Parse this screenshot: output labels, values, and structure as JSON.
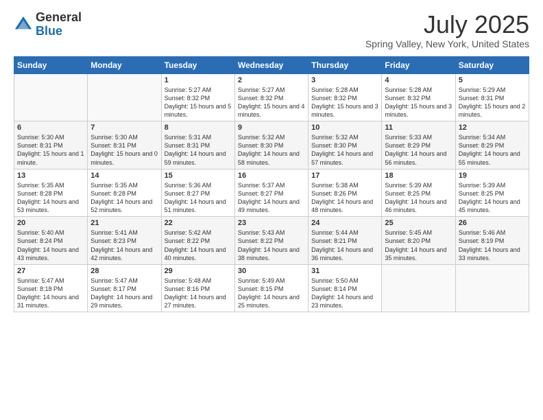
{
  "header": {
    "logo_general": "General",
    "logo_blue": "Blue",
    "month": "July 2025",
    "location": "Spring Valley, New York, United States"
  },
  "weekdays": [
    "Sunday",
    "Monday",
    "Tuesday",
    "Wednesday",
    "Thursday",
    "Friday",
    "Saturday"
  ],
  "weeks": [
    [
      {
        "day": "",
        "empty": true
      },
      {
        "day": "",
        "empty": true
      },
      {
        "day": "1",
        "sunrise": "Sunrise: 5:27 AM",
        "sunset": "Sunset: 8:32 PM",
        "daylight": "Daylight: 15 hours and 5 minutes."
      },
      {
        "day": "2",
        "sunrise": "Sunrise: 5:27 AM",
        "sunset": "Sunset: 8:32 PM",
        "daylight": "Daylight: 15 hours and 4 minutes."
      },
      {
        "day": "3",
        "sunrise": "Sunrise: 5:28 AM",
        "sunset": "Sunset: 8:32 PM",
        "daylight": "Daylight: 15 hours and 3 minutes."
      },
      {
        "day": "4",
        "sunrise": "Sunrise: 5:28 AM",
        "sunset": "Sunset: 8:32 PM",
        "daylight": "Daylight: 15 hours and 3 minutes."
      },
      {
        "day": "5",
        "sunrise": "Sunrise: 5:29 AM",
        "sunset": "Sunset: 8:31 PM",
        "daylight": "Daylight: 15 hours and 2 minutes."
      }
    ],
    [
      {
        "day": "6",
        "sunrise": "Sunrise: 5:30 AM",
        "sunset": "Sunset: 8:31 PM",
        "daylight": "Daylight: 15 hours and 1 minute."
      },
      {
        "day": "7",
        "sunrise": "Sunrise: 5:30 AM",
        "sunset": "Sunset: 8:31 PM",
        "daylight": "Daylight: 15 hours and 0 minutes."
      },
      {
        "day": "8",
        "sunrise": "Sunrise: 5:31 AM",
        "sunset": "Sunset: 8:31 PM",
        "daylight": "Daylight: 14 hours and 59 minutes."
      },
      {
        "day": "9",
        "sunrise": "Sunrise: 5:32 AM",
        "sunset": "Sunset: 8:30 PM",
        "daylight": "Daylight: 14 hours and 58 minutes."
      },
      {
        "day": "10",
        "sunrise": "Sunrise: 5:32 AM",
        "sunset": "Sunset: 8:30 PM",
        "daylight": "Daylight: 14 hours and 57 minutes."
      },
      {
        "day": "11",
        "sunrise": "Sunrise: 5:33 AM",
        "sunset": "Sunset: 8:29 PM",
        "daylight": "Daylight: 14 hours and 56 minutes."
      },
      {
        "day": "12",
        "sunrise": "Sunrise: 5:34 AM",
        "sunset": "Sunset: 8:29 PM",
        "daylight": "Daylight: 14 hours and 55 minutes."
      }
    ],
    [
      {
        "day": "13",
        "sunrise": "Sunrise: 5:35 AM",
        "sunset": "Sunset: 8:28 PM",
        "daylight": "Daylight: 14 hours and 53 minutes."
      },
      {
        "day": "14",
        "sunrise": "Sunrise: 5:35 AM",
        "sunset": "Sunset: 8:28 PM",
        "daylight": "Daylight: 14 hours and 52 minutes."
      },
      {
        "day": "15",
        "sunrise": "Sunrise: 5:36 AM",
        "sunset": "Sunset: 8:27 PM",
        "daylight": "Daylight: 14 hours and 51 minutes."
      },
      {
        "day": "16",
        "sunrise": "Sunrise: 5:37 AM",
        "sunset": "Sunset: 8:27 PM",
        "daylight": "Daylight: 14 hours and 49 minutes."
      },
      {
        "day": "17",
        "sunrise": "Sunrise: 5:38 AM",
        "sunset": "Sunset: 8:26 PM",
        "daylight": "Daylight: 14 hours and 48 minutes."
      },
      {
        "day": "18",
        "sunrise": "Sunrise: 5:39 AM",
        "sunset": "Sunset: 8:25 PM",
        "daylight": "Daylight: 14 hours and 46 minutes."
      },
      {
        "day": "19",
        "sunrise": "Sunrise: 5:39 AM",
        "sunset": "Sunset: 8:25 PM",
        "daylight": "Daylight: 14 hours and 45 minutes."
      }
    ],
    [
      {
        "day": "20",
        "sunrise": "Sunrise: 5:40 AM",
        "sunset": "Sunset: 8:24 PM",
        "daylight": "Daylight: 14 hours and 43 minutes."
      },
      {
        "day": "21",
        "sunrise": "Sunrise: 5:41 AM",
        "sunset": "Sunset: 8:23 PM",
        "daylight": "Daylight: 14 hours and 42 minutes."
      },
      {
        "day": "22",
        "sunrise": "Sunrise: 5:42 AM",
        "sunset": "Sunset: 8:22 PM",
        "daylight": "Daylight: 14 hours and 40 minutes."
      },
      {
        "day": "23",
        "sunrise": "Sunrise: 5:43 AM",
        "sunset": "Sunset: 8:22 PM",
        "daylight": "Daylight: 14 hours and 38 minutes."
      },
      {
        "day": "24",
        "sunrise": "Sunrise: 5:44 AM",
        "sunset": "Sunset: 8:21 PM",
        "daylight": "Daylight: 14 hours and 36 minutes."
      },
      {
        "day": "25",
        "sunrise": "Sunrise: 5:45 AM",
        "sunset": "Sunset: 8:20 PM",
        "daylight": "Daylight: 14 hours and 35 minutes."
      },
      {
        "day": "26",
        "sunrise": "Sunrise: 5:46 AM",
        "sunset": "Sunset: 8:19 PM",
        "daylight": "Daylight: 14 hours and 33 minutes."
      }
    ],
    [
      {
        "day": "27",
        "sunrise": "Sunrise: 5:47 AM",
        "sunset": "Sunset: 8:18 PM",
        "daylight": "Daylight: 14 hours and 31 minutes."
      },
      {
        "day": "28",
        "sunrise": "Sunrise: 5:47 AM",
        "sunset": "Sunset: 8:17 PM",
        "daylight": "Daylight: 14 hours and 29 minutes."
      },
      {
        "day": "29",
        "sunrise": "Sunrise: 5:48 AM",
        "sunset": "Sunset: 8:16 PM",
        "daylight": "Daylight: 14 hours and 27 minutes."
      },
      {
        "day": "30",
        "sunrise": "Sunrise: 5:49 AM",
        "sunset": "Sunset: 8:15 PM",
        "daylight": "Daylight: 14 hours and 25 minutes."
      },
      {
        "day": "31",
        "sunrise": "Sunrise: 5:50 AM",
        "sunset": "Sunset: 8:14 PM",
        "daylight": "Daylight: 14 hours and 23 minutes."
      },
      {
        "day": "",
        "empty": true
      },
      {
        "day": "",
        "empty": true
      }
    ]
  ]
}
